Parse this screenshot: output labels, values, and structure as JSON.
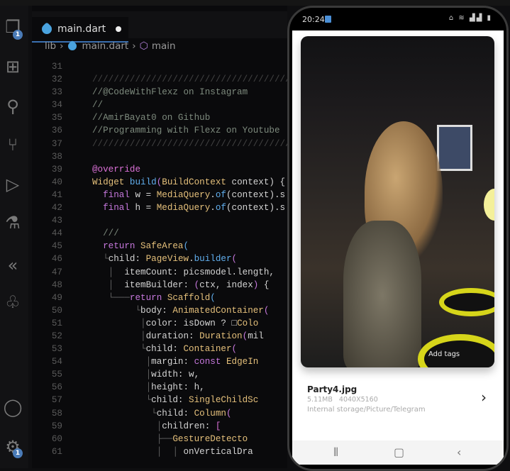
{
  "editor": {
    "tab": {
      "label": "main.dart",
      "modified": true
    },
    "breadcrumb": [
      "lib",
      "main.dart",
      "main"
    ],
    "activity_badges": {
      "explorer": "1",
      "settings": "1"
    },
    "lines": [
      {
        "n": "31",
        "s": []
      },
      {
        "n": "32",
        "s": [
          [
            "h",
            "//////////////////////////////////////"
          ]
        ]
      },
      {
        "n": "33",
        "s": [
          [
            "c",
            "//@CodeWithFlexz on Instagram"
          ]
        ]
      },
      {
        "n": "34",
        "s": [
          [
            "c",
            "//"
          ]
        ]
      },
      {
        "n": "35",
        "s": [
          [
            "c",
            "//AmirBayat0 on Github"
          ]
        ]
      },
      {
        "n": "36",
        "s": [
          [
            "c",
            "//Programming with Flexz on Youtube"
          ]
        ]
      },
      {
        "n": "37",
        "s": [
          [
            "h",
            "//////////////////////////////////////"
          ]
        ]
      },
      {
        "n": "38",
        "s": []
      },
      {
        "n": "39",
        "s": [
          [
            "p",
            "@override"
          ]
        ]
      },
      {
        "n": "40",
        "s": [
          [
            "y",
            "Widget "
          ],
          [
            "b",
            "build"
          ],
          [
            "k",
            "("
          ],
          [
            "y",
            "BuildContext "
          ],
          [
            "d",
            "context) {"
          ]
        ]
      },
      {
        "n": "41",
        "s": [
          [
            "d",
            "  "
          ],
          [
            "k",
            "final "
          ],
          [
            "d",
            "w = "
          ],
          [
            "y",
            "MediaQuery"
          ],
          [
            "d",
            "."
          ],
          [
            "b",
            "of"
          ],
          [
            "d",
            "(context).s"
          ]
        ]
      },
      {
        "n": "42",
        "s": [
          [
            "d",
            "  "
          ],
          [
            "k",
            "final "
          ],
          [
            "d",
            "h = "
          ],
          [
            "y",
            "MediaQuery"
          ],
          [
            "d",
            "."
          ],
          [
            "b",
            "of"
          ],
          [
            "d",
            "(context).s"
          ]
        ]
      },
      {
        "n": "43",
        "s": []
      },
      {
        "n": "44",
        "s": [
          [
            "c",
            "  ///"
          ]
        ]
      },
      {
        "n": "45",
        "s": [
          [
            "d",
            "  "
          ],
          [
            "k",
            "return "
          ],
          [
            "y",
            "SafeArea"
          ],
          [
            "b",
            "("
          ]
        ]
      },
      {
        "n": "46",
        "s": [
          [
            "g",
            "  └"
          ],
          [
            "d",
            "child: "
          ],
          [
            "y",
            "PageView"
          ],
          [
            "d",
            "."
          ],
          [
            "b",
            "builder"
          ],
          [
            "k",
            "("
          ]
        ]
      },
      {
        "n": "47",
        "s": [
          [
            "g",
            "   │  "
          ],
          [
            "d",
            "itemCount: picsmodel.length,"
          ]
        ]
      },
      {
        "n": "48",
        "s": [
          [
            "g",
            "   │  "
          ],
          [
            "d",
            "itemBuilder: "
          ],
          [
            "k",
            "("
          ],
          [
            "d",
            "ctx, index"
          ],
          [
            "k",
            ")"
          ],
          [
            "d",
            " {"
          ]
        ]
      },
      {
        "n": "49",
        "s": [
          [
            "g",
            "   └───"
          ],
          [
            "k",
            "return "
          ],
          [
            "y",
            "Scaffold"
          ],
          [
            "b",
            "("
          ]
        ]
      },
      {
        "n": "50",
        "s": [
          [
            "g",
            "        └"
          ],
          [
            "d",
            "body: "
          ],
          [
            "y",
            "AnimatedContainer"
          ],
          [
            "k",
            "("
          ]
        ]
      },
      {
        "n": "51",
        "s": [
          [
            "g",
            "         │"
          ],
          [
            "d",
            "color: isDown ? □"
          ],
          [
            "y",
            "Colo"
          ]
        ]
      },
      {
        "n": "52",
        "s": [
          [
            "g",
            "         │"
          ],
          [
            "d",
            "duration: "
          ],
          [
            "y",
            "Duration"
          ],
          [
            "k",
            "("
          ],
          [
            "d",
            "mil"
          ]
        ]
      },
      {
        "n": "53",
        "s": [
          [
            "g",
            "         └"
          ],
          [
            "d",
            "child: "
          ],
          [
            "y",
            "Container"
          ],
          [
            "k",
            "("
          ]
        ]
      },
      {
        "n": "54",
        "s": [
          [
            "g",
            "          │"
          ],
          [
            "d",
            "margin: "
          ],
          [
            "k",
            "const "
          ],
          [
            "y",
            "EdgeIn"
          ]
        ]
      },
      {
        "n": "55",
        "s": [
          [
            "g",
            "          │"
          ],
          [
            "d",
            "width: w,"
          ]
        ]
      },
      {
        "n": "56",
        "s": [
          [
            "g",
            "          │"
          ],
          [
            "d",
            "height: h,"
          ]
        ]
      },
      {
        "n": "57",
        "s": [
          [
            "g",
            "          └"
          ],
          [
            "d",
            "child: "
          ],
          [
            "y",
            "SingleChildSc"
          ]
        ]
      },
      {
        "n": "58",
        "s": [
          [
            "g",
            "           └"
          ],
          [
            "d",
            "child: "
          ],
          [
            "y",
            "Column"
          ],
          [
            "k",
            "("
          ]
        ]
      },
      {
        "n": "59",
        "s": [
          [
            "g",
            "            │"
          ],
          [
            "d",
            "children: "
          ],
          [
            "p",
            "["
          ]
        ]
      },
      {
        "n": "60",
        "s": [
          [
            "g",
            "            ├──"
          ],
          [
            "y",
            "GestureDetecto"
          ]
        ]
      },
      {
        "n": "61",
        "s": [
          [
            "g",
            "            │  │ "
          ],
          [
            "d",
            "onVerticalDra"
          ]
        ]
      }
    ]
  },
  "phone": {
    "status_time": "20:24",
    "photo_overlay": "Add tags",
    "file_name": "Party4.jpg",
    "file_size": "5.11MB",
    "dimensions": "4040X5160",
    "path": "Internal storage/Picture/Telegram"
  },
  "colors": {
    "accent": "#3a6fb0",
    "badge": "#4a7bb7",
    "keyword": "#c678dd",
    "type": "#e5c07b",
    "function": "#61afef"
  }
}
